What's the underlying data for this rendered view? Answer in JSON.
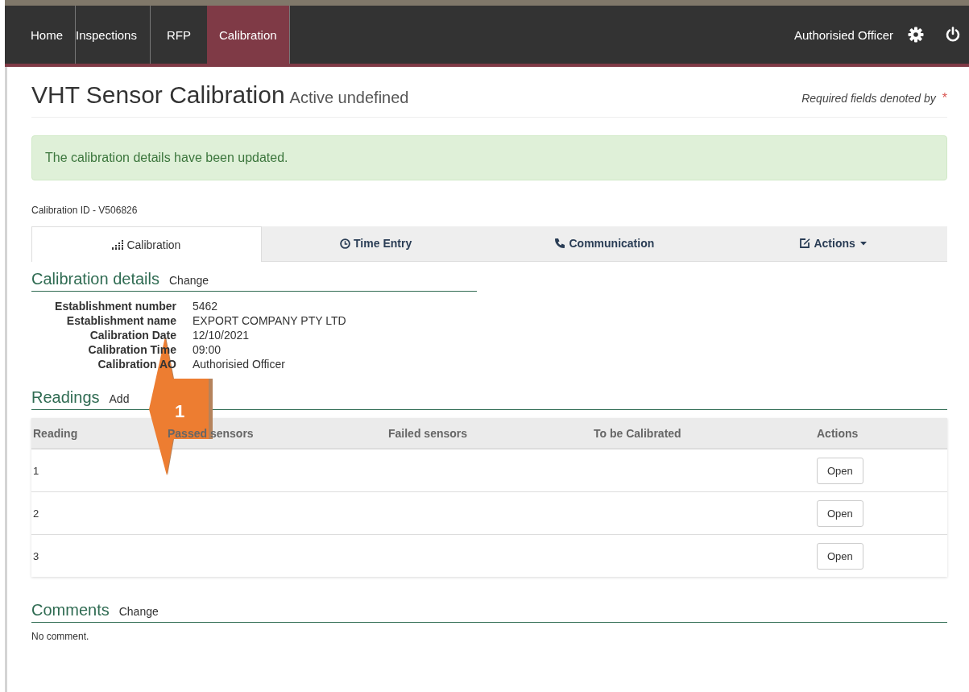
{
  "nav": {
    "items": [
      {
        "label": "Home",
        "selected": false
      },
      {
        "label": "Inspections",
        "selected": false
      },
      {
        "label": "RFP",
        "selected": false
      },
      {
        "label": "Calibration",
        "selected": true
      }
    ],
    "user": "Authorisied Officer"
  },
  "header": {
    "title": "VHT Sensor Calibration",
    "subtitle": "Active undefined",
    "required_note": "Required fields denoted by",
    "required_mark": "*"
  },
  "alert": "The calibration details have been updated.",
  "record_id": "Calibration ID - V506826",
  "tabs": [
    {
      "label": "Calibration",
      "selected": true
    },
    {
      "label": "Time Entry",
      "selected": false
    },
    {
      "label": "Communication",
      "selected": false
    },
    {
      "label": "Actions",
      "selected": false
    }
  ],
  "details": {
    "title": "Calibration details",
    "link": "Change",
    "fields": [
      {
        "label": "Establishment number",
        "value": "5462"
      },
      {
        "label": "Establishment name",
        "value": "EXPORT COMPANY PTY LTD"
      },
      {
        "label": "Calibration Date",
        "value": "12/10/2021"
      },
      {
        "label": "Calibration Time",
        "value": "09:00"
      },
      {
        "label": "Calibration AO",
        "value": "Authorisied Officer"
      }
    ]
  },
  "readings": {
    "title": "Readings",
    "link": "Add",
    "columns": [
      "Reading",
      "Passed sensors",
      "Failed sensors",
      "To be Calibrated",
      "Actions"
    ],
    "rows": [
      {
        "reading": "1",
        "action": "Open"
      },
      {
        "reading": "2",
        "action": "Open"
      },
      {
        "reading": "3",
        "action": "Open"
      }
    ]
  },
  "comments": {
    "title": "Comments",
    "link": "Change",
    "text": "No comment."
  },
  "callout": {
    "number": "1"
  }
}
